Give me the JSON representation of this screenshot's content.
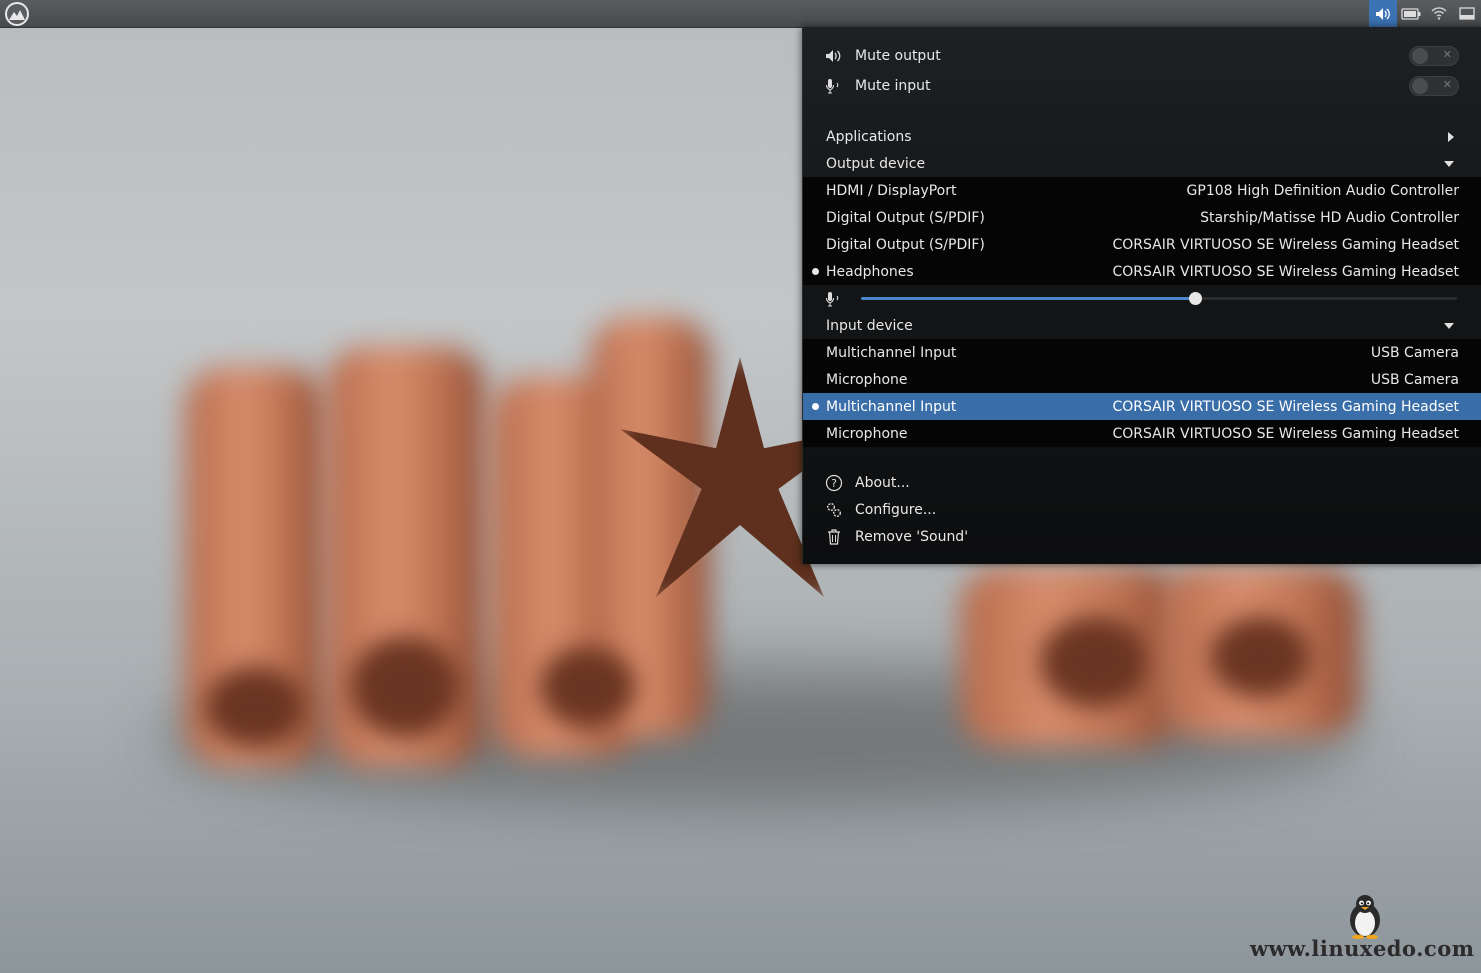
{
  "popup": {
    "mute_output": {
      "label": "Mute output",
      "on": false
    },
    "mute_input": {
      "label": "Mute input",
      "on": false
    },
    "applications_label": "Applications",
    "output_device_label": "Output device",
    "output_devices": [
      {
        "name": "HDMI / DisplayPort",
        "device": "GP108 High Definition Audio Controller",
        "active": false
      },
      {
        "name": "Digital Output (S/PDIF)",
        "device": "Starship/Matisse HD Audio Controller",
        "active": false
      },
      {
        "name": "Digital Output (S/PDIF)",
        "device": "CORSAIR VIRTUOSO SE Wireless Gaming Headset",
        "active": false
      },
      {
        "name": "Headphones",
        "device": "CORSAIR VIRTUOSO SE Wireless Gaming Headset",
        "active": true
      }
    ],
    "input_volume": 0.56,
    "input_device_label": "Input device",
    "input_devices": [
      {
        "name": "Multichannel Input",
        "device": "USB Camera",
        "active": false
      },
      {
        "name": "Microphone",
        "device": "USB Camera",
        "active": false
      },
      {
        "name": "Multichannel Input",
        "device": "CORSAIR VIRTUOSO SE Wireless Gaming Headset",
        "active": true
      },
      {
        "name": "Microphone",
        "device": "CORSAIR VIRTUOSO SE Wireless Gaming Headset",
        "active": false
      }
    ],
    "about_label": "About...",
    "configure_label": "Configure...",
    "remove_label": "Remove 'Sound'"
  },
  "watermark": "www.linuxedo.com",
  "icons": {
    "menu": "linux-mint-logo-icon",
    "tray": [
      "volume-icon",
      "battery-icon",
      "wifi-icon",
      "show-desktop-icon"
    ]
  },
  "colors": {
    "accent": "#3a6ea8",
    "popup_bg": "#141618"
  }
}
